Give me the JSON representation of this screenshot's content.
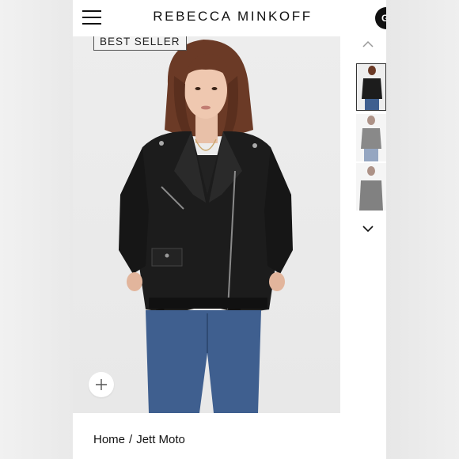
{
  "header": {
    "brand": "REBECCA MINKOFF",
    "right_circle_text": "G"
  },
  "product": {
    "badge": "BEST SELLER",
    "thumbnail_count": 3,
    "selected_thumbnail": 1
  },
  "breadcrumb": {
    "home": "Home",
    "separator": "/",
    "current": "Jett Moto"
  },
  "icons": {
    "menu": "hamburger-menu-icon",
    "zoom": "plus-icon",
    "up": "chevron-up-icon",
    "down": "chevron-down-icon"
  },
  "colors": {
    "text": "#111111",
    "image_bg": "#ebebeb",
    "jacket": "#1c1c1c",
    "jeans": "#3f5f8f"
  }
}
